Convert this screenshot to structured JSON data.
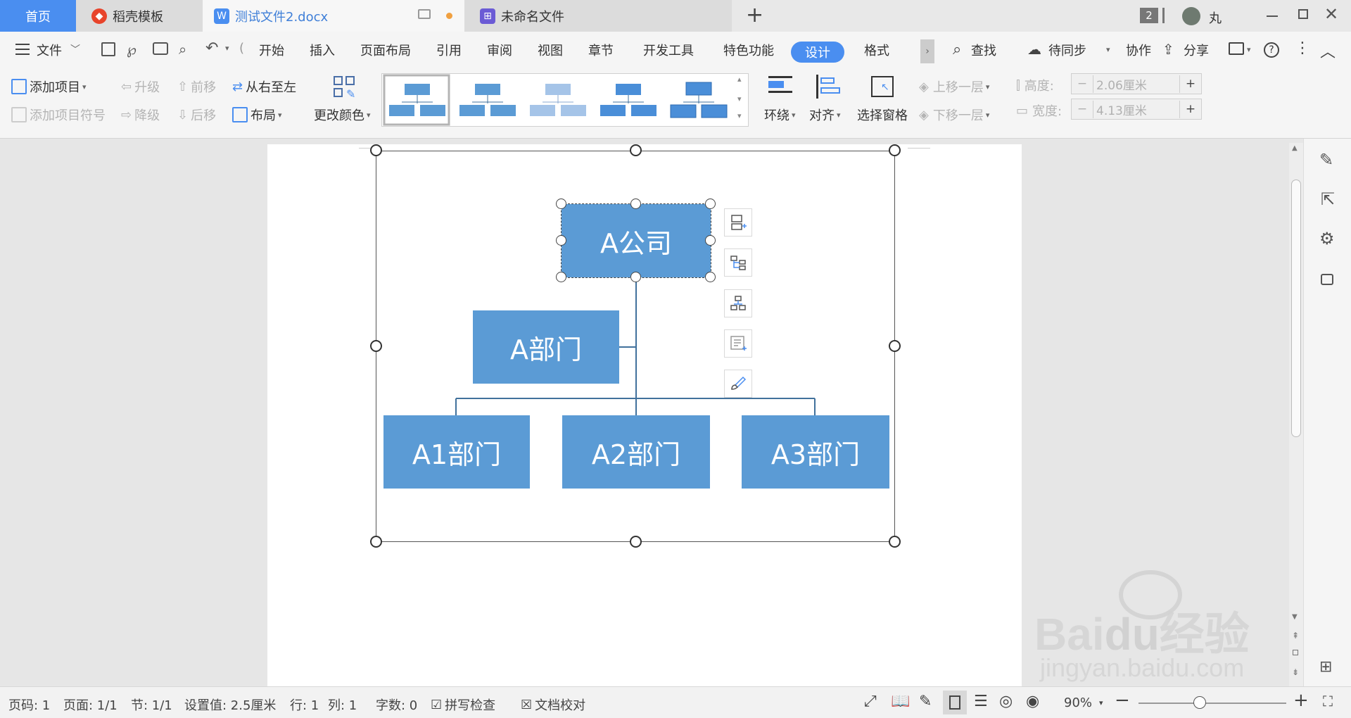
{
  "tabs": {
    "home": "首页",
    "template": "稻壳模板",
    "document": "测试文件2.docx",
    "new_file": "未命名文件",
    "notification_count": "2",
    "user_name": "丸"
  },
  "menu": {
    "file": "文件",
    "items": [
      "开始",
      "插入",
      "页面布局",
      "引用",
      "审阅",
      "视图",
      "章节",
      "开发工具",
      "特色功能",
      "设计",
      "格式"
    ],
    "active": "设计",
    "search": "查找",
    "sync": "待同步",
    "collab": "协作",
    "share": "分享"
  },
  "ribbon": {
    "add_item": "添加项目",
    "add_bullet": "添加项目符号",
    "promote": "升级",
    "demote": "降级",
    "move_forward": "前移",
    "move_back": "后移",
    "right_to_left": "从右至左",
    "layout": "布局",
    "change_color": "更改颜色",
    "wrap": "环绕",
    "align": "对齐",
    "selection_pane": "选择窗格",
    "bring_forward": "上移一层",
    "send_backward": "下移一层",
    "height_label": "高度:",
    "height_value": "2.06厘米",
    "width_label": "宽度:",
    "width_value": "4.13厘米"
  },
  "org_chart": {
    "root": "A公司",
    "assistant": "A部门",
    "children": [
      "A1部门",
      "A2部门",
      "A3部门"
    ]
  },
  "status": {
    "page_no": "页码: 1",
    "pages": "页面: 1/1",
    "section": "节: 1/1",
    "setting": "设置值: 2.5厘米",
    "row": "行: 1",
    "col": "列: 1",
    "words": "字数: 0",
    "spell": "拼写检查",
    "proof": "文档校对",
    "zoom": "90%"
  },
  "colors": {
    "accent": "#4a8ef0",
    "node_fill": "#5b9bd5",
    "connector": "#41719c"
  },
  "watermark": {
    "brand": "Baidu经验",
    "url": "jingyan.baidu.com"
  }
}
